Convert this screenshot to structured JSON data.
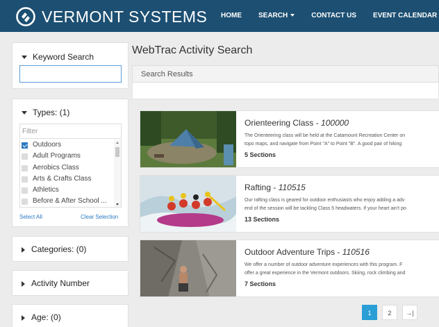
{
  "header": {
    "brand": "VERMONT SYSTEMS",
    "nav": [
      "HOME",
      "SEARCH",
      "CONTACT US",
      "EVENT CALENDAR"
    ]
  },
  "sidebar": {
    "keyword": {
      "title": "Keyword Search",
      "value": ""
    },
    "types": {
      "title": "Types:",
      "count": "(1)",
      "filter_placeholder": "Filter",
      "items": [
        {
          "label": "Outdoors",
          "checked": true
        },
        {
          "label": "Adult Programs",
          "checked": false
        },
        {
          "label": "Aerobics Class",
          "checked": false
        },
        {
          "label": "Arts & Crafts Class",
          "checked": false
        },
        {
          "label": "Athletics",
          "checked": false
        },
        {
          "label": "Before & After School ...",
          "checked": false
        }
      ],
      "select_all": "Select All",
      "clear_selection": "Clear Selection"
    },
    "categories": {
      "title": "Categories:",
      "count": "(0)"
    },
    "activity_number": {
      "title": "Activity Number"
    },
    "age": {
      "title": "Age:",
      "count": "(0)"
    }
  },
  "main": {
    "title": "WebTrac Activity Search",
    "results_label": "Search Results",
    "results": [
      {
        "name": "Orienteering Class - ",
        "code": "100000",
        "desc1": "The Orienteering class will be held at the Catamount Recreation Center on",
        "desc2": "topo maps, and navigate from Point \"A\" to Point \"B\". A good pair of hiking",
        "sections": "5 Sections"
      },
      {
        "name": "Rafting - ",
        "code": "110515",
        "desc1": "Our rafting class is geared for outdoor enthusiasts who enjoy adding a adv",
        "desc2": "end of the session will be tackling Class 5 headwaters. If your heart ain't po",
        "sections": "13 Sections"
      },
      {
        "name": "Outdoor Adventure Trips - ",
        "code": "110516",
        "desc1": "We offer a number of outdoor adventure experiences with this program. F",
        "desc2": "offer a great experience in the Vermont outdoors. Skiing, rock climbing and",
        "sections": "7 Sections"
      }
    ],
    "pagination": {
      "pages": [
        "1",
        "2"
      ],
      "current": "1",
      "last": "→|"
    }
  },
  "colors": {
    "header": "#1c4f72",
    "accent": "#2a9fd6",
    "link": "#2a7ac0"
  }
}
